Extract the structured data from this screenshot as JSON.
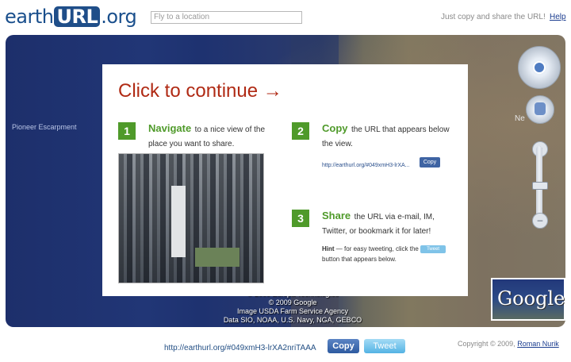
{
  "header": {
    "logo": {
      "part1": "earth",
      "part2": "URL",
      "part3": ".org"
    },
    "search_placeholder": "Fly to a location",
    "tagline": "Just copy and share the URL!",
    "help": "Help"
  },
  "map": {
    "label_escarpment": "Pioneer Escarpment",
    "label_ne": "Ne",
    "attribution": [
      "© 2009 Europa Technologies",
      "© 2009 Google",
      "Image USDA Farm Service Agency",
      "Data SIO, NOAA, U.S. Navy, NGA, GEBCO"
    ],
    "google_logo": "Google",
    "zoom_in": "+",
    "zoom_out": "–",
    "overview_year": "2009"
  },
  "overlay": {
    "heading": "Click to continue →",
    "step1": {
      "number": "1",
      "title": "Navigate",
      "text": "to a nice view of the place you want to share."
    },
    "step2": {
      "number": "2",
      "title": "Copy",
      "text": "the URL that appears below the view.",
      "example_url": "http://earthurl.org/#049xmH3-lrXA...",
      "copy_label": "Copy"
    },
    "step3": {
      "number": "3",
      "title": "Share",
      "text": "the URL via e-mail, IM, Twitter, or bookmark it for later!"
    },
    "hint": {
      "bold": "Hint",
      "text1": "— for easy tweeting, click the",
      "tweet_label": "Tweet",
      "text2": "button that appears below."
    }
  },
  "footer": {
    "url": "http://earthurl.org/#049xmH3-lrXA2nriTAAA",
    "copy_label": "Copy",
    "tweet_label": "Tweet",
    "copyright": "Copyright © 2009,",
    "author": "Roman Nurik"
  }
}
